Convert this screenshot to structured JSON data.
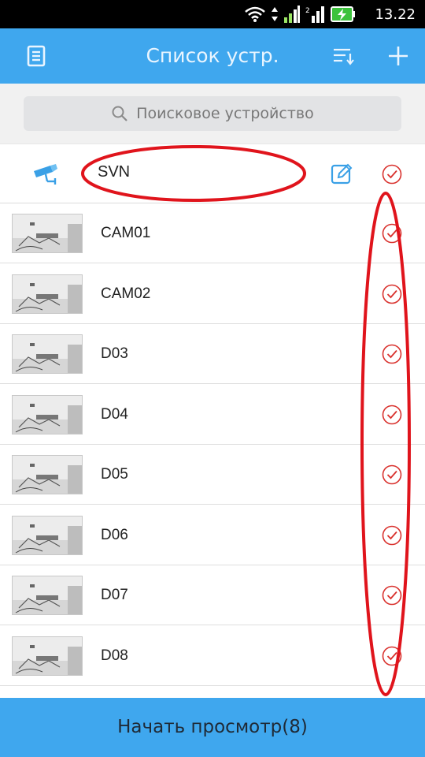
{
  "status_bar": {
    "time": "13.22"
  },
  "header": {
    "title": "Список устр.",
    "left_icon": "list-icon",
    "sort_icon": "sort-icon",
    "add_icon": "plus-icon"
  },
  "search": {
    "placeholder": "Поисковое устройство",
    "icon": "search-icon"
  },
  "group": {
    "name": "SVN",
    "icon": "camera-icon",
    "edit_icon": "edit-icon",
    "checked": true
  },
  "devices": [
    {
      "name": "CAM01",
      "checked": true
    },
    {
      "name": "CAM02",
      "checked": true
    },
    {
      "name": "D03",
      "checked": true
    },
    {
      "name": "D04",
      "checked": true
    },
    {
      "name": "D05",
      "checked": true
    },
    {
      "name": "D06",
      "checked": true
    },
    {
      "name": "D07",
      "checked": true
    },
    {
      "name": "D08",
      "checked": true
    }
  ],
  "footer": {
    "label": "Начать просмотр(8)"
  },
  "colors": {
    "accent": "#3fa7ee",
    "check": "#d9322e",
    "annotation": "#e0141c"
  }
}
